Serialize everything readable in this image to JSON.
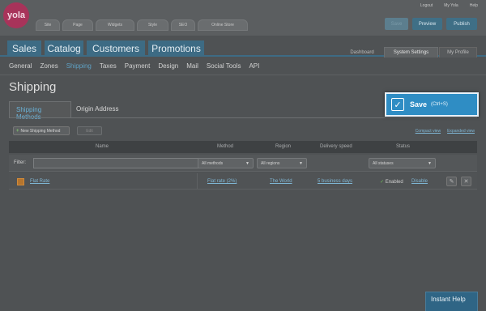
{
  "logo": {
    "text": "yola"
  },
  "top_tabs": [
    {
      "label": "Site",
      "w": 30
    },
    {
      "label": "Page",
      "w": 38
    },
    {
      "label": "Widgets",
      "w": 48
    },
    {
      "label": "Style",
      "w": 39
    },
    {
      "label": "SEO",
      "w": 30
    },
    {
      "label": "Online Store",
      "w": 62
    }
  ],
  "util_links": [
    "Logout",
    "My Yola",
    "Help"
  ],
  "top_buttons": {
    "save": "Save",
    "preview": "Preview",
    "publish": "Publish"
  },
  "main_tabs": [
    "Sales",
    "Catalog",
    "Customers",
    "Promotions"
  ],
  "right_tabs": {
    "dashboard": "Dashboard",
    "system": "System Settings",
    "profile": "My Profile"
  },
  "sub_nav": [
    "General",
    "Zones",
    "Shipping",
    "Taxes",
    "Payment",
    "Design",
    "Mail",
    "Social Tools",
    "API"
  ],
  "page_title": "Shipping",
  "section_tabs": {
    "methods": "Shipping Methods",
    "origin": "Origin Address"
  },
  "save_highlight": {
    "label": "Save",
    "shortcut": "(Ctrl+S)"
  },
  "actions": {
    "new_method": "New Shipping Method",
    "edit": "Edit"
  },
  "view_links": [
    "Compact view",
    "Expanded view"
  ],
  "table": {
    "columns": [
      "Name",
      "Method",
      "Region",
      "Delivery speed",
      "Status"
    ],
    "filter_label": "Filter:",
    "filters": {
      "method": "All methods",
      "region": "All regions",
      "status": "All statuses"
    },
    "rows": [
      {
        "name": "Flat Rate",
        "method": "Flat rate (2%)",
        "region": "The World",
        "speed": "5 business days",
        "status": "Enabled",
        "action": "Disable"
      }
    ]
  },
  "instant_help": "Instant Help"
}
